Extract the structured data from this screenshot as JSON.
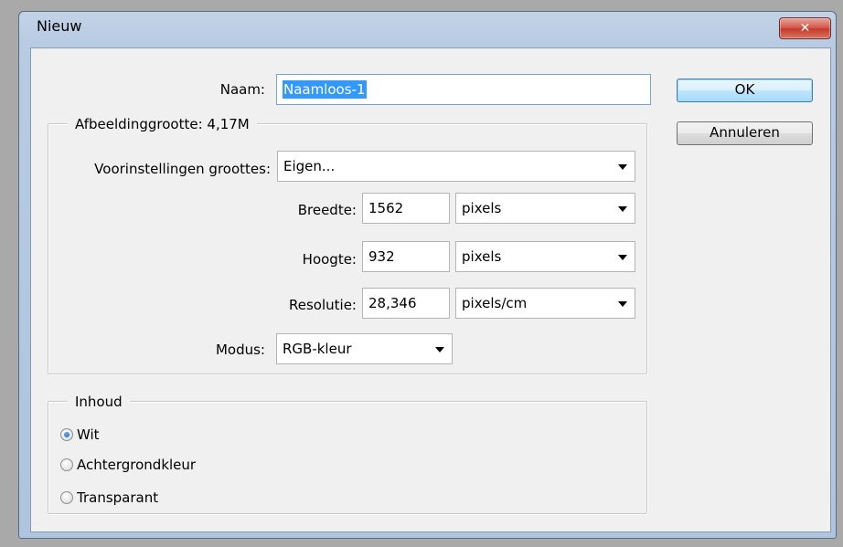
{
  "window": {
    "title": "Nieuw",
    "close_symbol": "✕"
  },
  "name_field": {
    "label": "Naam:",
    "value": "Naamloos-1"
  },
  "image_size": {
    "legend": "Afbeeldinggrootte: 4,17M",
    "preset": {
      "label": "Voorinstellingen groottes:",
      "value": "Eigen..."
    },
    "width": {
      "label": "Breedte:",
      "value": "1562",
      "unit": "pixels"
    },
    "height": {
      "label": "Hoogte:",
      "value": "932",
      "unit": "pixels"
    },
    "resolution": {
      "label": "Resolutie:",
      "value": "28,346",
      "unit": "pixels/cm"
    },
    "mode": {
      "label": "Modus:",
      "value": "RGB-kleur"
    }
  },
  "content": {
    "legend": "Inhoud",
    "options": [
      {
        "label": "Wit",
        "checked": true
      },
      {
        "label": "Achtergrondkleur",
        "checked": false
      },
      {
        "label": "Transparant",
        "checked": false
      }
    ]
  },
  "buttons": {
    "ok": "OK",
    "cancel": "Annuleren"
  },
  "icons": {
    "close": "close-icon",
    "dropdown": "chevron-down-icon",
    "radio": "radio-button"
  },
  "colors": {
    "selection": "#3399ff",
    "close_button": "#c9432f",
    "dialog_bg": "#f0f0f0",
    "title_bar": "#b7cbe3"
  }
}
